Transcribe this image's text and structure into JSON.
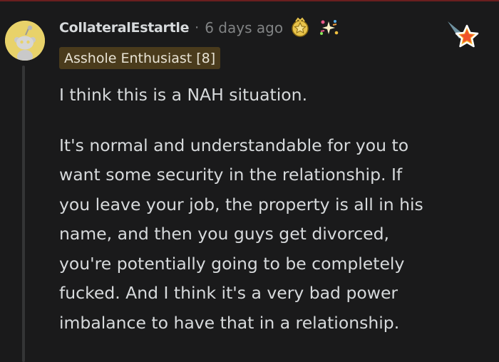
{
  "comment": {
    "username": "CollateralEstartle",
    "separator": "·",
    "timestamp": "6 days ago",
    "flair": "Asshole Enthusiast [8]",
    "paragraphs": [
      [
        "I think this is a NAH situation."
      ],
      [
        "It's normal and understandable for you to",
        "want some security in the relationship. If",
        "you leave your job, the property is all in his",
        "name, and then you guys get divorced,",
        "you're potentially going to be completely",
        "fucked. And I think it's a very bad power",
        "imbalance to have that in a relationship."
      ]
    ],
    "awards": [
      "gold-medal-icon",
      "sparkle-burst-icon"
    ],
    "corner_icon": "shooting-star-icon"
  },
  "colors": {
    "background": "#1a1a1b",
    "text": "#d7dadc",
    "meta": "#818384",
    "flair_bg": "#4a3b1c",
    "avatar_bg": "#e8d26a",
    "thread_line": "#343536"
  }
}
